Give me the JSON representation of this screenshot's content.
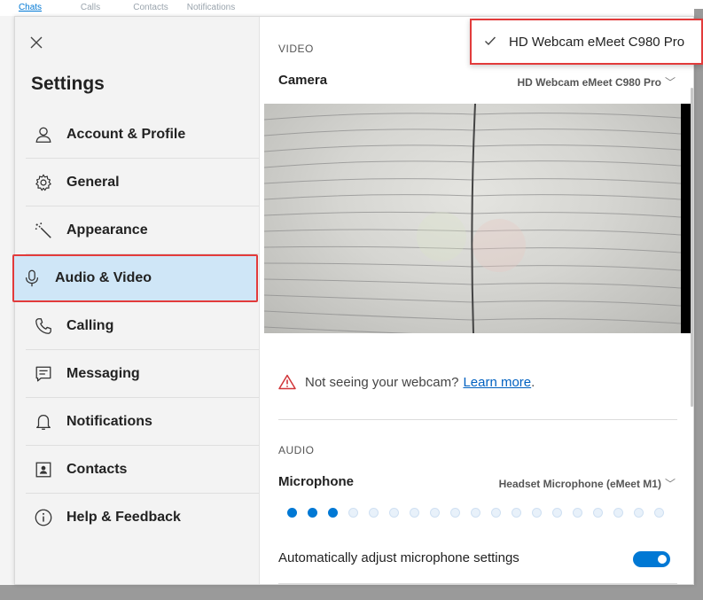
{
  "background_app": {
    "tabs": [
      {
        "label": "Chats",
        "active": true
      },
      {
        "label": "Calls",
        "active": false
      },
      {
        "label": "Contacts",
        "active": false
      },
      {
        "label": "Notifications",
        "active": false
      }
    ]
  },
  "settings": {
    "title": "Settings",
    "nav": [
      {
        "label": "Account & Profile",
        "icon": "person-icon"
      },
      {
        "label": "General",
        "icon": "gear-icon"
      },
      {
        "label": "Appearance",
        "icon": "magic-wand-icon"
      },
      {
        "label": "Audio & Video",
        "icon": "microphone-icon",
        "selected": true
      },
      {
        "label": "Calling",
        "icon": "phone-icon"
      },
      {
        "label": "Messaging",
        "icon": "message-icon"
      },
      {
        "label": "Notifications",
        "icon": "bell-icon"
      },
      {
        "label": "Contacts",
        "icon": "contact-card-icon"
      },
      {
        "label": "Help & Feedback",
        "icon": "info-icon"
      }
    ]
  },
  "video": {
    "section_label": "VIDEO",
    "camera_label": "Camera",
    "camera_value": "HD Webcam eMeet C980 Pro",
    "warning_text": "Not seeing your webcam?",
    "warning_link": "Learn more",
    "warning_suffix": "."
  },
  "audio": {
    "section_label": "AUDIO",
    "microphone_label": "Microphone",
    "microphone_value": "Headset Microphone (eMeet M1)",
    "mic_level_dots_total": 19,
    "mic_level_dots_active": 3,
    "auto_adjust_label": "Automatically adjust microphone settings",
    "auto_adjust_on": true
  },
  "camera_dropdown": {
    "selected_option": "HD Webcam eMeet C980 Pro"
  },
  "colors": {
    "accent": "#0078d4",
    "selected_bg": "#cfe6f7",
    "highlight_border": "#e23b3b",
    "warning": "#d13438"
  }
}
